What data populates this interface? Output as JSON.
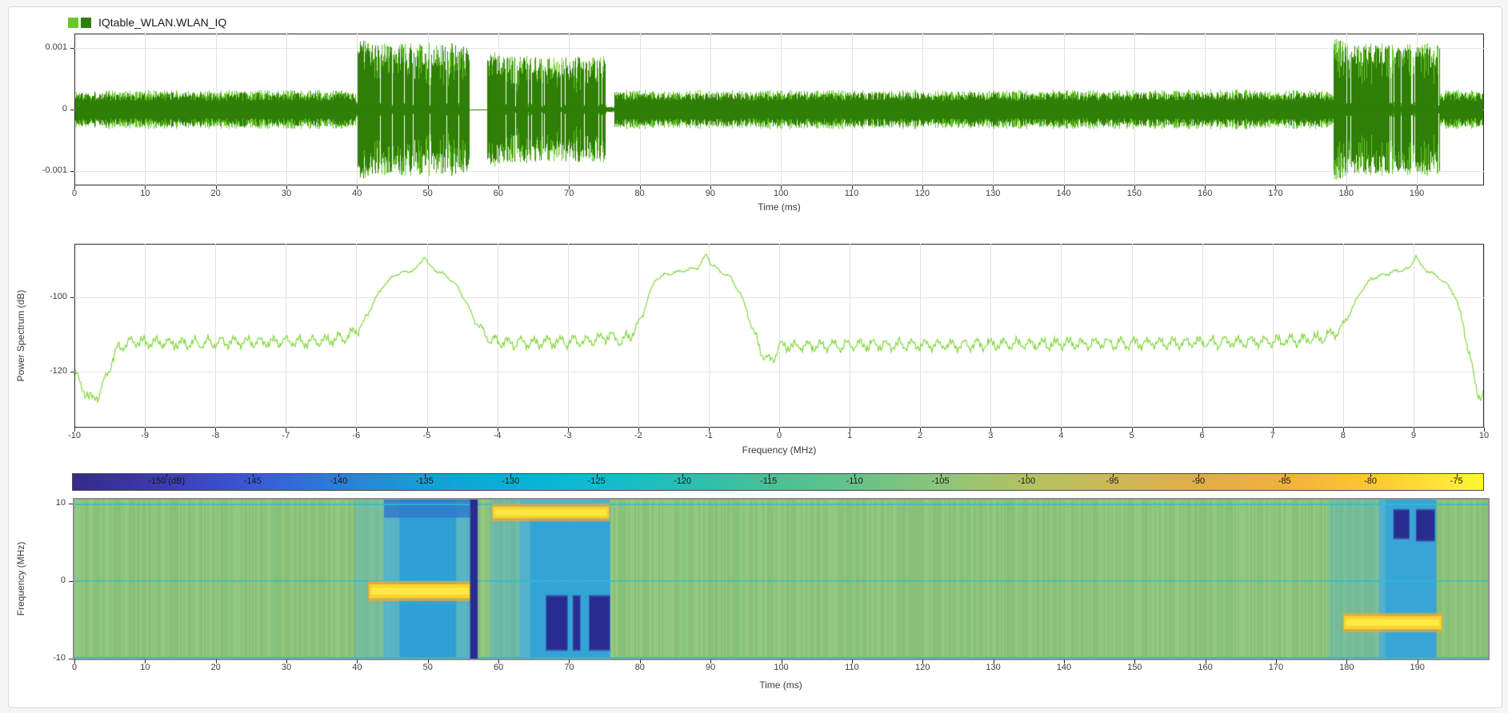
{
  "legend": {
    "label": "IQtable_WLAN.WLAN_IQ"
  },
  "colors": {
    "trace_light": "#68c72b",
    "trace_dark": "#2f7e06",
    "spectrum_line": "#76d42c",
    "grid": "#e3e3e3",
    "axis": "#2b2b2b",
    "spectro_bg": "#8fc67b",
    "spectro_cyan": "#2ebecd",
    "spectro_blue": "#45aede",
    "spectro_blue_core": "#259bdb",
    "spectro_blue_dark": "#2e77cc",
    "spectro_navy": "#272a8f",
    "spectro_yellow": "#fbd32b",
    "spectro_yellow_core": "#ffe945",
    "spectro_orange": "#e8a93c"
  },
  "chart_data": [
    {
      "id": "time-waveform",
      "type": "line",
      "legend": "IQtable_WLAN.WLAN_IQ",
      "xlabel": "Time (ms)",
      "xlim": [
        0,
        199.5
      ],
      "ylim": [
        -0.001234,
        0.001234
      ],
      "grid": true,
      "xticks": [
        0,
        10,
        20,
        30,
        40,
        50,
        60,
        70,
        80,
        90,
        100,
        110,
        120,
        130,
        140,
        150,
        160,
        170,
        180,
        190
      ],
      "yticks": [
        {
          "v": 0.001,
          "label": "0.001"
        },
        {
          "v": 0,
          "label": "0"
        },
        {
          "v": -0.001,
          "label": "-0.001"
        }
      ],
      "series": [
        {
          "name": "real",
          "color_key": "trace_light"
        },
        {
          "name": "imag",
          "color_key": "trace_dark"
        }
      ],
      "envelope_segments": [
        {
          "t0": 0,
          "t1": 39.8,
          "amp": 0.00032,
          "kind": "noise"
        },
        {
          "t0": 39.8,
          "t1": 55.9,
          "amp": 0.00108,
          "kind": "burst"
        },
        {
          "t0": 55.9,
          "t1": 58.4,
          "amp": 0,
          "kind": "flat"
        },
        {
          "t0": 58.4,
          "t1": 75.2,
          "amp": 0.00088,
          "kind": "burst"
        },
        {
          "t0": 75.2,
          "t1": 76.4,
          "amp": 5e-05,
          "kind": "flat"
        },
        {
          "t0": 76.4,
          "t1": 178.2,
          "amp": 0.00032,
          "kind": "noise"
        },
        {
          "t0": 178.2,
          "t1": 193.2,
          "amp": 0.00108,
          "kind": "burst"
        },
        {
          "t0": 193.2,
          "t1": 199.6,
          "amp": 0.00032,
          "kind": "noise"
        }
      ]
    },
    {
      "id": "power-spectrum",
      "type": "line",
      "ylabel": "Power Spectrum (dB)",
      "xlabel": "Frequency (MHz)",
      "xlim": [
        -10,
        10
      ],
      "ylim": [
        -135,
        -85.6
      ],
      "grid": true,
      "xticks": [
        -10,
        -9,
        -8,
        -7,
        -6,
        -5,
        -4,
        -3,
        -2,
        -1,
        0,
        1,
        2,
        3,
        4,
        5,
        6,
        7,
        8,
        9,
        10
      ],
      "yticks": [
        {
          "v": -100,
          "label": "-100"
        },
        {
          "v": -120,
          "label": "-120"
        }
      ],
      "ripple": {
        "amp1": 1.15,
        "period1": 0.185,
        "amp2": 0.5,
        "period2": 0.045,
        "jitter": 1.1
      },
      "anchors": [
        [
          -10,
          -119.5
        ],
        [
          -9.9,
          -124
        ],
        [
          -9.78,
          -127.5
        ],
        [
          -9.65,
          -126
        ],
        [
          -9.5,
          -119
        ],
        [
          -9.38,
          -113.5
        ],
        [
          -9.2,
          -112
        ],
        [
          -8.5,
          -112.3
        ],
        [
          -7.5,
          -112
        ],
        [
          -6.5,
          -111.8
        ],
        [
          -6.1,
          -110.5
        ],
        [
          -5.9,
          -107
        ],
        [
          -5.75,
          -101
        ],
        [
          -5.6,
          -96.5
        ],
        [
          -5.45,
          -94
        ],
        [
          -5.3,
          -93.2
        ],
        [
          -5.15,
          -92.5
        ],
        [
          -5.03,
          -88.8
        ],
        [
          -4.97,
          -91.5
        ],
        [
          -4.85,
          -93
        ],
        [
          -4.7,
          -94.5
        ],
        [
          -4.55,
          -97.5
        ],
        [
          -4.4,
          -103
        ],
        [
          -4.25,
          -108.5
        ],
        [
          -4.1,
          -111.5
        ],
        [
          -3.8,
          -112.2
        ],
        [
          -3.2,
          -112
        ],
        [
          -2.7,
          -111.8
        ],
        [
          -2.4,
          -110.3
        ],
        [
          -2.25,
          -111.8
        ],
        [
          -2.1,
          -110
        ],
        [
          -1.95,
          -105.5
        ],
        [
          -1.85,
          -99.5
        ],
        [
          -1.75,
          -95
        ],
        [
          -1.6,
          -93.8
        ],
        [
          -1.45,
          -93.2
        ],
        [
          -1.3,
          -92.6
        ],
        [
          -1.15,
          -92
        ],
        [
          -1.03,
          -88.2
        ],
        [
          -0.97,
          -91
        ],
        [
          -0.85,
          -92.8
        ],
        [
          -0.7,
          -94.5
        ],
        [
          -0.55,
          -99
        ],
        [
          -0.45,
          -104
        ],
        [
          -0.35,
          -110
        ],
        [
          -0.25,
          -114.5
        ],
        [
          -0.15,
          -117.3
        ],
        [
          -0.07,
          -116
        ],
        [
          0,
          -112.8
        ],
        [
          0.15,
          -113.2
        ],
        [
          0.5,
          -113
        ],
        [
          1.5,
          -112.8
        ],
        [
          3,
          -112.6
        ],
        [
          4.5,
          -112.4
        ],
        [
          6,
          -112.2
        ],
        [
          7,
          -111.8
        ],
        [
          7.7,
          -111
        ],
        [
          7.95,
          -109
        ],
        [
          8.1,
          -104
        ],
        [
          8.25,
          -98.5
        ],
        [
          8.4,
          -95
        ],
        [
          8.55,
          -94
        ],
        [
          8.75,
          -93
        ],
        [
          8.95,
          -92.2
        ],
        [
          9.03,
          -88.5
        ],
        [
          9.1,
          -91.5
        ],
        [
          9.2,
          -92.8
        ],
        [
          9.35,
          -94.5
        ],
        [
          9.5,
          -97
        ],
        [
          9.6,
          -100
        ],
        [
          9.7,
          -107
        ],
        [
          9.8,
          -116
        ],
        [
          9.88,
          -124
        ],
        [
          9.95,
          -127
        ],
        [
          10,
          -125.5
        ]
      ]
    },
    {
      "id": "spectrogram",
      "type": "heatmap",
      "ylabel": "Frequency (MHz)",
      "xlabel": "Time (ms)",
      "xlim": [
        0,
        200
      ],
      "ylim": [
        -10,
        10.5
      ],
      "xticks": [
        0,
        10,
        20,
        30,
        40,
        50,
        60,
        70,
        80,
        90,
        100,
        110,
        120,
        130,
        140,
        150,
        160,
        170,
        180,
        190
      ],
      "yticks": [
        {
          "v": 10,
          "label": "10"
        },
        {
          "v": 0,
          "label": "0"
        },
        {
          "v": -10,
          "label": "-10"
        }
      ],
      "background_db": -105,
      "colorbar": {
        "range": [
          -155.5,
          -73.4
        ],
        "labels": [
          {
            "v": -150,
            "label": "-150 (dB)"
          },
          {
            "v": -145,
            "label": "-145"
          },
          {
            "v": -140,
            "label": "-140"
          },
          {
            "v": -135,
            "label": "-135"
          },
          {
            "v": -130,
            "label": "-130"
          },
          {
            "v": -125,
            "label": "-125"
          },
          {
            "v": -120,
            "label": "-120"
          },
          {
            "v": -115,
            "label": "-115"
          },
          {
            "v": -110,
            "label": "-110"
          },
          {
            "v": -105,
            "label": "-105"
          },
          {
            "v": -100,
            "label": "-100"
          },
          {
            "v": -95,
            "label": "-95"
          },
          {
            "v": -90,
            "label": "-90"
          },
          {
            "v": -85,
            "label": "-85"
          },
          {
            "v": -80,
            "label": "-80"
          },
          {
            "v": -75,
            "label": "-75"
          }
        ],
        "gradient": [
          [
            "#352a87",
            0
          ],
          [
            "#3d3cb4",
            0.067
          ],
          [
            "#3a59d9",
            0.128
          ],
          [
            "#2c7ed9",
            0.189
          ],
          [
            "#14a0d5",
            0.25
          ],
          [
            "#07b1d5",
            0.311
          ],
          [
            "#0fbcd0",
            0.372
          ],
          [
            "#27c0b3",
            0.433
          ],
          [
            "#46c194",
            0.494
          ],
          [
            "#67c18b",
            0.554
          ],
          [
            "#8dc57b",
            0.615
          ],
          [
            "#b2c263",
            0.676
          ],
          [
            "#ccb954",
            0.737
          ],
          [
            "#dfae47",
            0.798
          ],
          [
            "#f0b13c",
            0.859
          ],
          [
            "#fbc831",
            0.92
          ],
          [
            "#fdea3b",
            0.98
          ],
          [
            "#fdf92a",
            1
          ]
        ]
      },
      "features": {
        "dc_line_f": 0,
        "edge_line_f": 9.9,
        "blue_rects": [
          {
            "t0": 39.6,
            "t1": 43.8,
            "f0": -10,
            "f1": 10.5,
            "fill": "blue",
            "alpha": 0.3
          },
          {
            "t0": 43.8,
            "t1": 56.0,
            "f0": -10,
            "f1": 10.5,
            "fill": "blue",
            "alpha": 0.75
          },
          {
            "t0": 46.0,
            "t1": 54.0,
            "f0": -10,
            "f1": 10.5,
            "fill": "blueCore",
            "alpha": 0.8
          },
          {
            "t0": 43.8,
            "t1": 56.0,
            "f0": 8.2,
            "f1": 10.5,
            "fill": "blueDark",
            "alpha": 0.8
          },
          {
            "t0": 58.9,
            "t1": 63.0,
            "f0": -10,
            "f1": 10.5,
            "fill": "blue",
            "alpha": 0.45
          },
          {
            "t0": 63.0,
            "t1": 75.8,
            "f0": -10,
            "f1": 10.5,
            "fill": "blue",
            "alpha": 0.8
          },
          {
            "t0": 64.5,
            "t1": 75.8,
            "f0": -10,
            "f1": 8.2,
            "fill": "blueCore",
            "alpha": 0.65
          },
          {
            "t0": 177.5,
            "t1": 184.6,
            "f0": -10,
            "f1": 10.5,
            "fill": "blue",
            "alpha": 0.3
          },
          {
            "t0": 184.6,
            "t1": 192.7,
            "f0": -10,
            "f1": 10.5,
            "fill": "blue",
            "alpha": 0.85
          },
          {
            "t0": 185.5,
            "t1": 192.7,
            "f0": -10,
            "f1": 10.5,
            "fill": "blueCore",
            "alpha": 0.55
          }
        ],
        "navy_rects": [
          {
            "t0": 56.05,
            "t1": 57.0,
            "f0": -10.3,
            "f1": 10.6
          },
          {
            "t0": 66.8,
            "t1": 69.7,
            "f0": -8.8,
            "f1": -2.0
          },
          {
            "t0": 70.6,
            "t1": 71.5,
            "f0": -8.8,
            "f1": -2.0
          },
          {
            "t0": 72.9,
            "t1": 75.7,
            "f0": -8.8,
            "f1": -2.0
          },
          {
            "t0": 186.7,
            "t1": 188.8,
            "f0": 5.6,
            "f1": 9.1
          },
          {
            "t0": 189.9,
            "t1": 192.4,
            "f0": 5.3,
            "f1": 9.1
          }
        ],
        "yellow_bars": [
          {
            "t0": 41.7,
            "t1": 56.1,
            "f0": -2.2,
            "f1": -0.4
          },
          {
            "t0": 59.2,
            "t1": 75.6,
            "f0": 8.1,
            "f1": 9.6
          },
          {
            "t0": 179.6,
            "t1": 193.4,
            "f0": -6.2,
            "f1": -4.5
          }
        ]
      }
    }
  ]
}
